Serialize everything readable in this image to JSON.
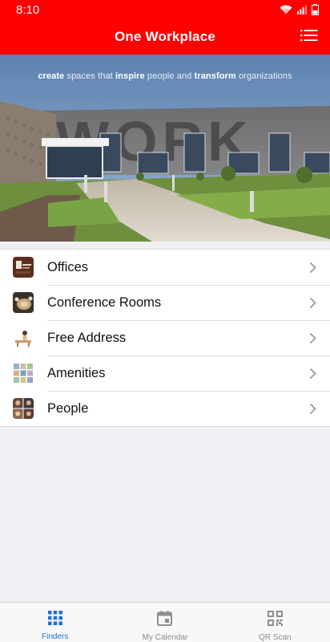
{
  "status_bar": {
    "time": "8:10",
    "icons": [
      "wifi-icon",
      "signal-icon",
      "battery-icon"
    ]
  },
  "app_bar": {
    "title": "One Workplace",
    "menu_icon": "list-menu-icon"
  },
  "hero": {
    "tagline": {
      "w1": "create",
      "t1": " spaces that ",
      "w2": "inspire",
      "t2": " people and ",
      "w3": "transform",
      "t3": " organizations"
    },
    "building_text": "WORK"
  },
  "finder_list": {
    "items": [
      {
        "label": "Offices",
        "icon": "offices-thumbnail"
      },
      {
        "label": "Conference Rooms",
        "icon": "conference-rooms-thumbnail"
      },
      {
        "label": "Free Address",
        "icon": "free-address-thumbnail"
      },
      {
        "label": "Amenities",
        "icon": "amenities-thumbnail"
      },
      {
        "label": "People",
        "icon": "people-thumbnail"
      }
    ]
  },
  "tab_bar": {
    "tabs": [
      {
        "label": "Finders",
        "icon": "grid-icon",
        "active": true
      },
      {
        "label": "My Calendar",
        "icon": "calendar-icon",
        "active": false
      },
      {
        "label": "QR Scan",
        "icon": "qr-code-icon",
        "active": false
      }
    ]
  },
  "colors": {
    "brand_red": "#ff0000",
    "active_tab": "#1f6fd9",
    "inactive_tab": "#8e8e93",
    "background": "#efeff4"
  }
}
